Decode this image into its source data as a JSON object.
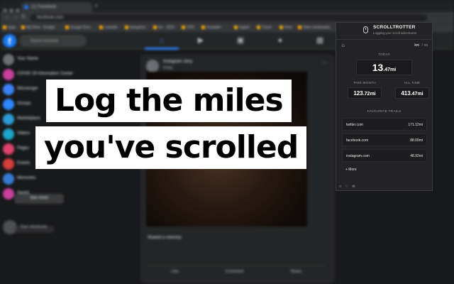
{
  "browser": {
    "tab_title": "(1) Facebook",
    "new_tab_glyph": "+",
    "url": "facebook.com",
    "bookmarks": [
      "Apps",
      "My Drive - Google",
      "Google Docs",
      "Linkedin",
      "bangalore",
      "bm - 2019",
      "2020",
      "Kundalini",
      "Gigmit",
      "Travel",
      "Wise",
      "Other bookmarks"
    ]
  },
  "facebook": {
    "logo": "f",
    "search_placeholder": "Search Facebook",
    "sidebar": [
      "Your Name",
      "COVID-19 Information Center",
      "Messenger",
      "Groups",
      "Marketplace",
      "Videos",
      "Pages",
      "Events",
      "Memories",
      "Saved"
    ],
    "see_more": "See more",
    "shortcuts_label": "Your shortcuts",
    "post": {
      "name": "Instagram story",
      "time": "Friday",
      "caption": "Shared a memory",
      "caption2": "",
      "actions": [
        "Like",
        "Comment",
        "Share"
      ]
    }
  },
  "headline": {
    "line1": "Log the miles",
    "line2": "you've scrolled"
  },
  "popup": {
    "brand": "SCROLLTROTTER",
    "tagline": "Logging your scroll adventures",
    "unit_km": "km",
    "unit_sep": "/",
    "unit_mi": "mi",
    "today_label": "TODAY",
    "today_whole": "13",
    "today_dec": ".47mi",
    "month_label": "THIS MONTH",
    "month_whole": "123",
    "month_dec": ".72mi",
    "alltime_label": "ALL TIME",
    "alltime_whole": "413",
    "alltime_dec": ".47mi",
    "favourites_label": "FAVOURITE TRAILS",
    "trails": [
      {
        "name": "twitter.com",
        "value": "171.12mi"
      },
      {
        "name": "facebook.com",
        "value": "88.09mi"
      },
      {
        "name": "instagram.com",
        "value": "48.92mi"
      }
    ],
    "more": "+ More",
    "icons": [
      "instagram-icon",
      "heart-icon",
      "mail-icon"
    ]
  }
}
